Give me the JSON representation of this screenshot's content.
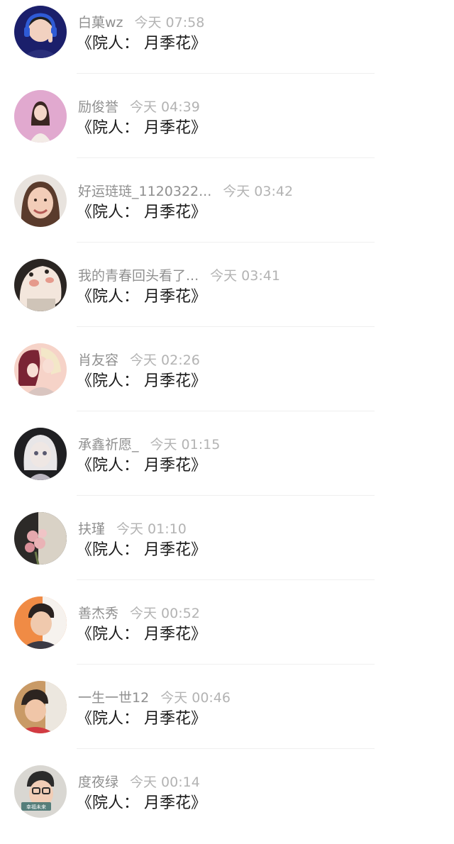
{
  "comments": [
    {
      "name": "白菓wz",
      "time": "今天 07:58",
      "text": "《院人： 月季花》",
      "avatar": "avatar-boy-headset",
      "avatar_colors": [
        "#1b1f6b",
        "#2f5bd6",
        "#f2d1c0"
      ]
    },
    {
      "name": "励俊誉",
      "time": "今天 04:39",
      "text": "《院人： 月季花》",
      "avatar": "avatar-girl-pink",
      "avatar_colors": [
        "#f0b9d4",
        "#c78bc7",
        "#3a2622"
      ]
    },
    {
      "name": "好运琏琏_1120322...",
      "time": "今天 03:42",
      "text": "《院人： 月季花》",
      "avatar": "avatar-girl-smile",
      "avatar_colors": [
        "#e8e3de",
        "#5a3b2c",
        "#f2cdb8"
      ]
    },
    {
      "name": "我的青春回头看了...",
      "time": "今天 03:41",
      "text": "《院人： 月季花》",
      "avatar": "avatar-cartoon-bear",
      "avatar_colors": [
        "#2a2522",
        "#f3e6dc",
        "#e59a8c"
      ]
    },
    {
      "name": "肖友容",
      "time": "今天 02:26",
      "text": "《院人： 月季花》",
      "avatar": "avatar-anime-couple",
      "avatar_colors": [
        "#f6d3c8",
        "#7a2434",
        "#f3e7c8"
      ]
    },
    {
      "name": "承鑫祈愿_",
      "time": "今天 01:15",
      "text": "《院人： 月季花》",
      "avatar": "avatar-doll",
      "avatar_colors": [
        "#1f1f22",
        "#e8e6e8",
        "#b9b4bf"
      ]
    },
    {
      "name": "扶瑾",
      "time": "今天 01:10",
      "text": "《院人： 月季花》",
      "avatar": "avatar-flowers",
      "avatar_colors": [
        "#2c2a28",
        "#e5a8ad",
        "#d9d2c6"
      ]
    },
    {
      "name": "善杰秀",
      "time": "今天 00:52",
      "text": "《院人： 月季花》",
      "avatar": "avatar-boy-orange",
      "avatar_colors": [
        "#f08b45",
        "#3c3a44",
        "#f0c9ad"
      ]
    },
    {
      "name": "一生一世12",
      "time": "今天 00:46",
      "text": "《院人： 月季花》",
      "avatar": "avatar-boy-red",
      "avatar_colors": [
        "#c99a66",
        "#d23b42",
        "#f0c6a8"
      ]
    },
    {
      "name": "度夜绿",
      "time": "今天 00:14",
      "text": "《院人： 月季花》",
      "avatar": "avatar-boy-glasses",
      "avatar_colors": [
        "#d9d7d2",
        "#2b2b2b",
        "#f1cdb6"
      ],
      "avatar_caption": "幸福未来"
    }
  ]
}
